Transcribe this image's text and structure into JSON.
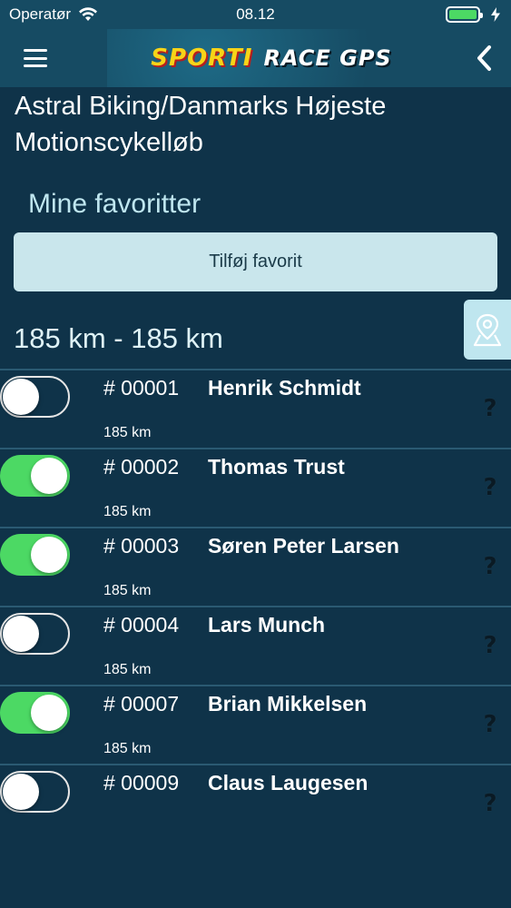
{
  "status_bar": {
    "carrier": "Operatør",
    "time": "08.12"
  },
  "nav": {
    "logo_primary": "SPORTI",
    "logo_secondary": "RACE GPS",
    "menu_icon": "hamburger-menu-icon",
    "back_icon": "chevron-left-icon"
  },
  "event": {
    "title": "Astral Biking/Danmarks Højeste Motionscykelløb"
  },
  "favorites": {
    "heading": "Mine favoritter",
    "add_button_label": "Tilføj favorit"
  },
  "distance_range": "185 km - 185 km",
  "riders": [
    {
      "bib": "# 00001",
      "name": "Henrik Schmidt",
      "distance": "185 km",
      "favorite": false
    },
    {
      "bib": "# 00002",
      "name": "Thomas Trust",
      "distance": "185 km",
      "favorite": true
    },
    {
      "bib": "# 00003",
      "name": "Søren Peter Larsen",
      "distance": "185 km",
      "favorite": true
    },
    {
      "bib": "# 00004",
      "name": "Lars Munch",
      "distance": "185 km",
      "favorite": false
    },
    {
      "bib": "# 00007",
      "name": "Brian Mikkelsen",
      "distance": "185 km",
      "favorite": true
    },
    {
      "bib": "# 00009",
      "name": "Claus Laugesen",
      "distance": "",
      "favorite": false
    }
  ],
  "help_symbol": "?",
  "colors": {
    "background": "#0f3349",
    "navbar": "#164b63",
    "accent_light": "#bfe6ef",
    "toggle_on": "#4cd964",
    "logo_yellow": "#f7d418"
  }
}
